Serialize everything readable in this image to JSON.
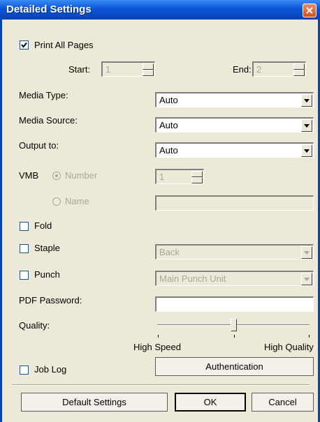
{
  "window": {
    "title": "Detailed Settings"
  },
  "print_all_pages": {
    "label": "Print All Pages",
    "checked": true
  },
  "start": {
    "label": "Start:",
    "value": "1"
  },
  "end": {
    "label": "End:",
    "value": "2"
  },
  "media_type": {
    "label": "Media Type:",
    "value": "Auto"
  },
  "media_source": {
    "label": "Media Source:",
    "value": "Auto"
  },
  "output_to": {
    "label": "Output to:",
    "value": "Auto"
  },
  "vmb": {
    "label": "VMB",
    "number_label": "Number",
    "name_label": "Name",
    "number_value": "1",
    "selected": "Number"
  },
  "fold": {
    "label": "Fold",
    "checked": false
  },
  "staple": {
    "label": "Staple",
    "checked": false,
    "value": "Back"
  },
  "punch": {
    "label": "Punch",
    "checked": false,
    "value": "Main Punch Unit"
  },
  "pdf_password": {
    "label": "PDF Password:",
    "value": ""
  },
  "quality": {
    "label": "Quality:",
    "min_label": "High Speed",
    "max_label": "High Quality",
    "level": 0.5
  },
  "job_log": {
    "label": "Job Log",
    "checked": false
  },
  "buttons": {
    "authentication": "Authentication",
    "default_settings": "Default Settings",
    "ok": "OK",
    "cancel": "Cancel"
  },
  "colors": {
    "titlebar": "#0a55d8",
    "face": "#ece9d8",
    "disabled_text": "#aca899"
  }
}
